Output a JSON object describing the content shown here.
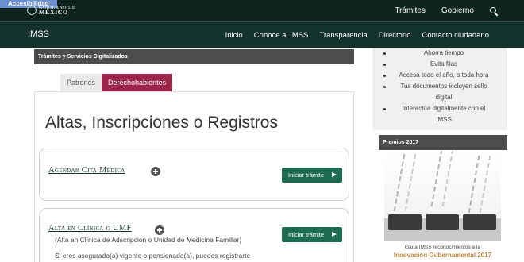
{
  "topbar": {
    "accessibility": "Accesibilidad",
    "logo_line1": "GOBIERNO DE",
    "logo_line2": "MÉXICO",
    "links": [
      "Trámites",
      "Gobierno"
    ],
    "search_icon": "search-icon"
  },
  "navbar": {
    "brand": "IMSS",
    "items": [
      "Inicio",
      "Conoce al IMSS",
      "Transparencia",
      "Directorio",
      "Contacto ciudadano"
    ]
  },
  "section": {
    "header": "Trámites y Servicios Digitalizados"
  },
  "tabs": {
    "items": [
      "Patrones",
      "Derechohabientes"
    ],
    "active": "Derechohabientes"
  },
  "page": {
    "title": "Altas, Inscripciones o Registros"
  },
  "services": [
    {
      "title": "Agendar Cita Médica",
      "button": "Iniciar trámite"
    },
    {
      "title": "Alta en Clínica o UMF",
      "subtitle": "(Alta en Clínica de Adscripción o Unidad de Medicina Familiar)",
      "description": "Si eres asegurado(a) vigente o pensionado(a), puedes registrarte",
      "button": "Iniciar trámite"
    }
  ],
  "sidebar": {
    "benefits": [
      "Ahorra tiempo",
      "Evita filas",
      "Accesa todo el año, a toda hora",
      "Tus documentos incluyen sello",
      "digital",
      "Interactúa digitalmente con el",
      "IMSS"
    ],
    "awards_header": "Premios 2017",
    "awards_caption": "Gana IMSS reconocimientos a la",
    "awards_highlight": "Innovación Gubernamental 2017"
  },
  "colors": {
    "topbar": "#0c231e",
    "navbar": "#13322b",
    "accent": "#9d2449",
    "button": "#1e6b53",
    "highlight": "#c0883a"
  }
}
